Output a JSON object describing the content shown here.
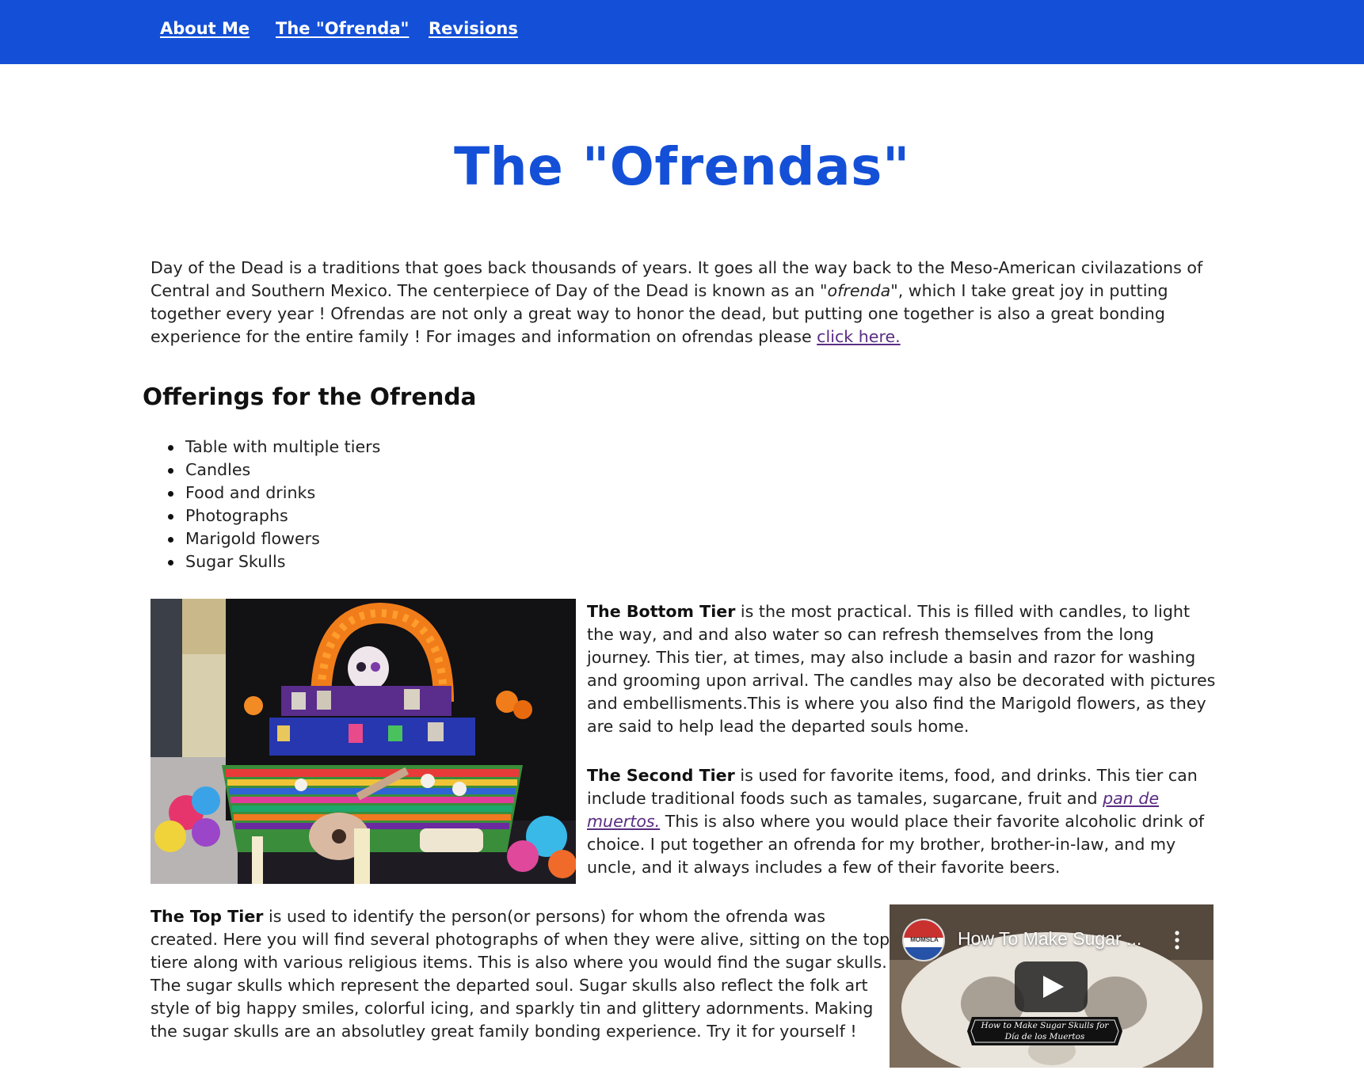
{
  "nav": {
    "items": [
      {
        "label": "About Me"
      },
      {
        "label": "The \"Ofrenda\""
      },
      {
        "label": "Revisions"
      }
    ]
  },
  "page": {
    "title": "The \"Ofrendas\""
  },
  "intro": {
    "part1": "Day of the Dead is a traditions that goes back thousands of years. It goes all the way back to the Meso-American civilazations of Central and Southern Mexico. The centerpiece of Day of the Dead is known as an \"",
    "italic_word": "ofrenda",
    "part2": "\", which I take great joy in putting together every year ! Ofrendas are not only a great way to honor the dead, but putting one together is also a great bonding experience for the entire family ! For images and information on ofrendas please ",
    "link": "click here."
  },
  "offerings": {
    "heading": "Offerings for the Ofrenda",
    "items": [
      "Table with multiple tiers",
      "Candles",
      "Food and drinks",
      "Photographs",
      "Marigold flowers",
      "Sugar Skulls"
    ]
  },
  "tiers": {
    "bottom": {
      "label": "The Bottom Tier",
      "text": " is the most practical. This is filled with candles, to light the way, and and also water so can refresh themselves from the long journey. This tier, at times, may also include a basin and razor for washing and grooming upon arrival. The candles may also be decorated with pictures and embellisments.This is where you also find the Marigold flowers, as they are said to help lead the departed souls home."
    },
    "second": {
      "label": "The Second Tier",
      "text1": " is used for favorite items, food, and drinks. This tier can include traditional foods such as tamales, sugarcane, fruit and ",
      "link": "pan de muertos.",
      "text2": " This is also where you would place their favorite alcoholic drink of choice. I put together an ofrenda for my brother, brother-in-law, and my uncle, and it always includes a few of their favorite beers."
    },
    "top": {
      "label": "The Top Tier",
      "text": " is used to identify the person(or persons) for whom the ofrenda was created. Here you will find several photographs of when they were alive, sitting on the top tiere along with various religious items. This is also where you would find the sugar skulls. The sugar skulls which represent the departed soul. Sugar skulls also reflect the folk art style of big happy smiles, colorful icing, and sparkly tin and glittery adornments. Making the sugar skulls are an absolutley great family bonding experience. Try it for yourself !"
    }
  },
  "video": {
    "title": "How To Make Sugar ...",
    "channel_logo_text": "MOMSLA",
    "banner_line1": "How to Make Sugar Skulls for",
    "banner_line2": "Día de los Muertos"
  },
  "colors": {
    "nav_bg": "#1450d7",
    "title": "#1450d7",
    "visited_link": "#5a2d82"
  }
}
